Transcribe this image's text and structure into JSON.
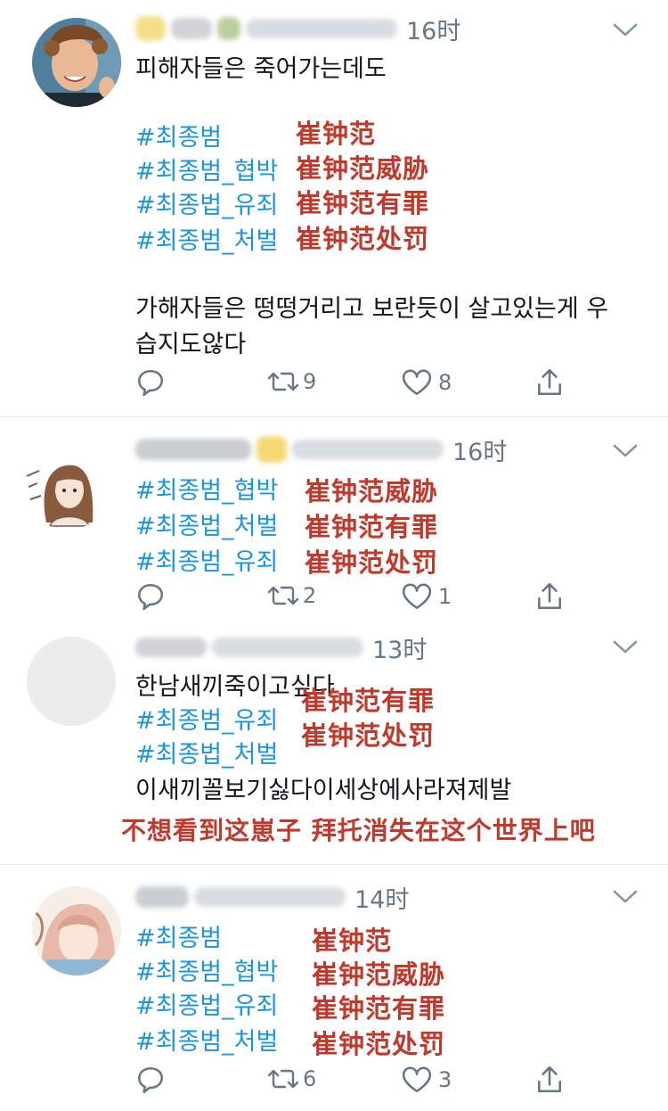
{
  "tweets": [
    {
      "time": "16时",
      "texts": [
        "피해자들은 죽어가는데도"
      ],
      "hashtags": [
        "#최종범",
        "#최종범_협박",
        "#최종법_유죄",
        "#최종범_처벌"
      ],
      "translations": [
        "崔钟范",
        "崔钟范威胁",
        "崔钟范有罪",
        "崔钟范处罚"
      ],
      "body2": [
        "가해자들은 떵떵거리고 보란듯이 살고있는게 우",
        "습지도않다"
      ],
      "retweets": "9",
      "likes": "8"
    },
    {
      "time": "16时",
      "hashtags": [
        "#최종범_협박",
        "#최종법_처벌",
        "#최종범_유죄"
      ],
      "translations": [
        "崔钟范威胁",
        "崔钟范有罪",
        "崔钟范处罚"
      ],
      "retweets": "2",
      "likes": "1"
    },
    {
      "time": "13时",
      "texts": [
        "한남새끼죽이고싶다"
      ],
      "hashtags": [
        "#최종범_유죄",
        "#최종법_처벌"
      ],
      "translations": [
        "崔钟范有罪",
        "崔钟范处罚"
      ],
      "body2": [
        "이새끼꼴보기싫다이세상에사라져제발"
      ],
      "caption": "不想看到这崽子 拜托消失在这个世界上吧"
    },
    {
      "time": "14时",
      "hashtags": [
        "#최종범",
        "#최종범_협박",
        "#최종법_유죄",
        "#최종범_처벌"
      ],
      "translations": [
        "崔钟范",
        "崔钟范威胁",
        "崔钟范有罪",
        "崔钟范处罚"
      ],
      "retweets": "6",
      "likes": "3"
    }
  ],
  "icons": [
    "reply-icon",
    "retweet-icon",
    "like-icon",
    "share-icon",
    "chevron-down-icon"
  ],
  "colors": {
    "hashtag": "#1b95e0",
    "translation": "#c0392b",
    "meta": "#657786",
    "divider": "#e1e8ed"
  }
}
